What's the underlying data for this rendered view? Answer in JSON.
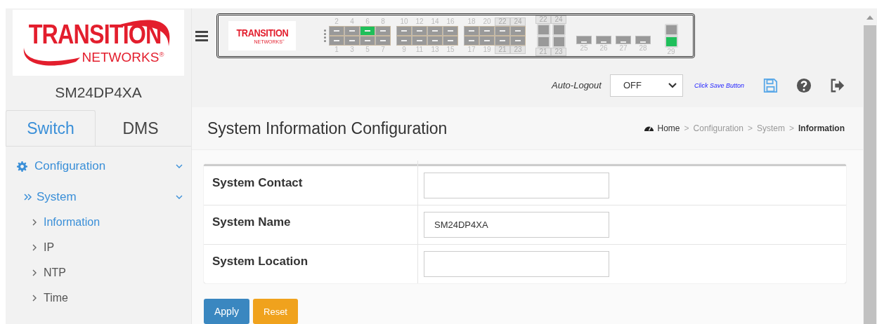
{
  "logo": {
    "line1": "TRANSITION",
    "line2": "NETWORKS$^{®}$"
  },
  "device_name": "SM24DP4XA",
  "sidebar_tabs": [
    {
      "label": "Switch",
      "selected": true
    },
    {
      "label": "DMS",
      "selected": false
    }
  ],
  "menu": [
    {
      "label": "Configuration",
      "expanded": true,
      "children": [
        {
          "label": "System",
          "expanded": true,
          "children": [
            {
              "label": "Information",
              "selected": true
            },
            {
              "label": "IP",
              "selected": false
            },
            {
              "label": "NTP",
              "selected": false
            },
            {
              "label": "Time",
              "selected": false
            }
          ]
        }
      ]
    }
  ],
  "panel": {
    "logo": {
      "line1": "TRANSITION",
      "line2": "NETWORKS$^{®}$"
    },
    "groups": [
      {
        "kind": "sfp",
        "top": [
          {
            "label": "2",
            "up": false
          },
          {
            "label": "4",
            "up": false
          },
          {
            "label": "6",
            "up": true
          },
          {
            "label": "8",
            "up": false
          }
        ],
        "bottom": [
          {
            "label": "1",
            "up": false
          },
          {
            "label": "3",
            "up": false
          },
          {
            "label": "5",
            "up": false
          },
          {
            "label": "7",
            "up": false
          }
        ]
      },
      {
        "kind": "sfp",
        "top": [
          {
            "label": "10",
            "up": false
          },
          {
            "label": "12",
            "up": false
          },
          {
            "label": "14",
            "up": false
          },
          {
            "label": "16",
            "up": false
          }
        ],
        "bottom": [
          {
            "label": "9",
            "up": false
          },
          {
            "label": "11",
            "up": false
          },
          {
            "label": "13",
            "up": false
          },
          {
            "label": "15",
            "up": false
          }
        ]
      },
      {
        "kind": "sfp",
        "top": [
          {
            "label": "18",
            "up": false
          },
          {
            "label": "20",
            "up": false
          },
          {
            "label": "22",
            "up": false,
            "boxed": true
          },
          {
            "label": "24",
            "up": false,
            "boxed": true
          }
        ],
        "bottom": [
          {
            "label": "17",
            "up": false
          },
          {
            "label": "19",
            "up": false
          },
          {
            "label": "21",
            "up": false,
            "boxed": true
          },
          {
            "label": "23",
            "up": false,
            "boxed": true
          }
        ]
      },
      {
        "kind": "rj45",
        "top": [
          {
            "label": "22",
            "up": false,
            "boxed": true
          },
          {
            "label": "24",
            "up": false,
            "boxed": true
          }
        ],
        "bottom": [
          {
            "label": "21",
            "up": false,
            "boxed": true
          },
          {
            "label": "23",
            "up": false,
            "boxed": true
          }
        ]
      },
      {
        "kind": "single",
        "bottom": [
          {
            "label": "25",
            "up": false
          },
          {
            "label": "26",
            "up": false
          },
          {
            "label": "27",
            "up": false
          },
          {
            "label": "28",
            "up": false
          }
        ]
      },
      {
        "kind": "mgmt",
        "bottom": [
          {
            "label": "29",
            "up": true
          }
        ]
      }
    ]
  },
  "toolbar": {
    "auto_logout_label": "Auto-Logout",
    "auto_logout_value": "OFF",
    "save_hint": "Click Save Button"
  },
  "page_title": "System Information Configuration",
  "breadcrumb": [
    {
      "label": "Home",
      "current": false
    },
    {
      "label": "Configuration",
      "current": false
    },
    {
      "label": "System",
      "current": false
    },
    {
      "label": "Information",
      "current": true
    }
  ],
  "breadcrumb_separator": ">",
  "form": [
    {
      "label": "System Contact"
    },
    {
      "label": "System Name",
      "value": "SM24DP4XA"
    },
    {
      "label": "System Location"
    }
  ],
  "buttons": [
    {
      "label": "Apply",
      "kind": "primary"
    },
    {
      "label": "Reset",
      "kind": "warning"
    }
  ]
}
